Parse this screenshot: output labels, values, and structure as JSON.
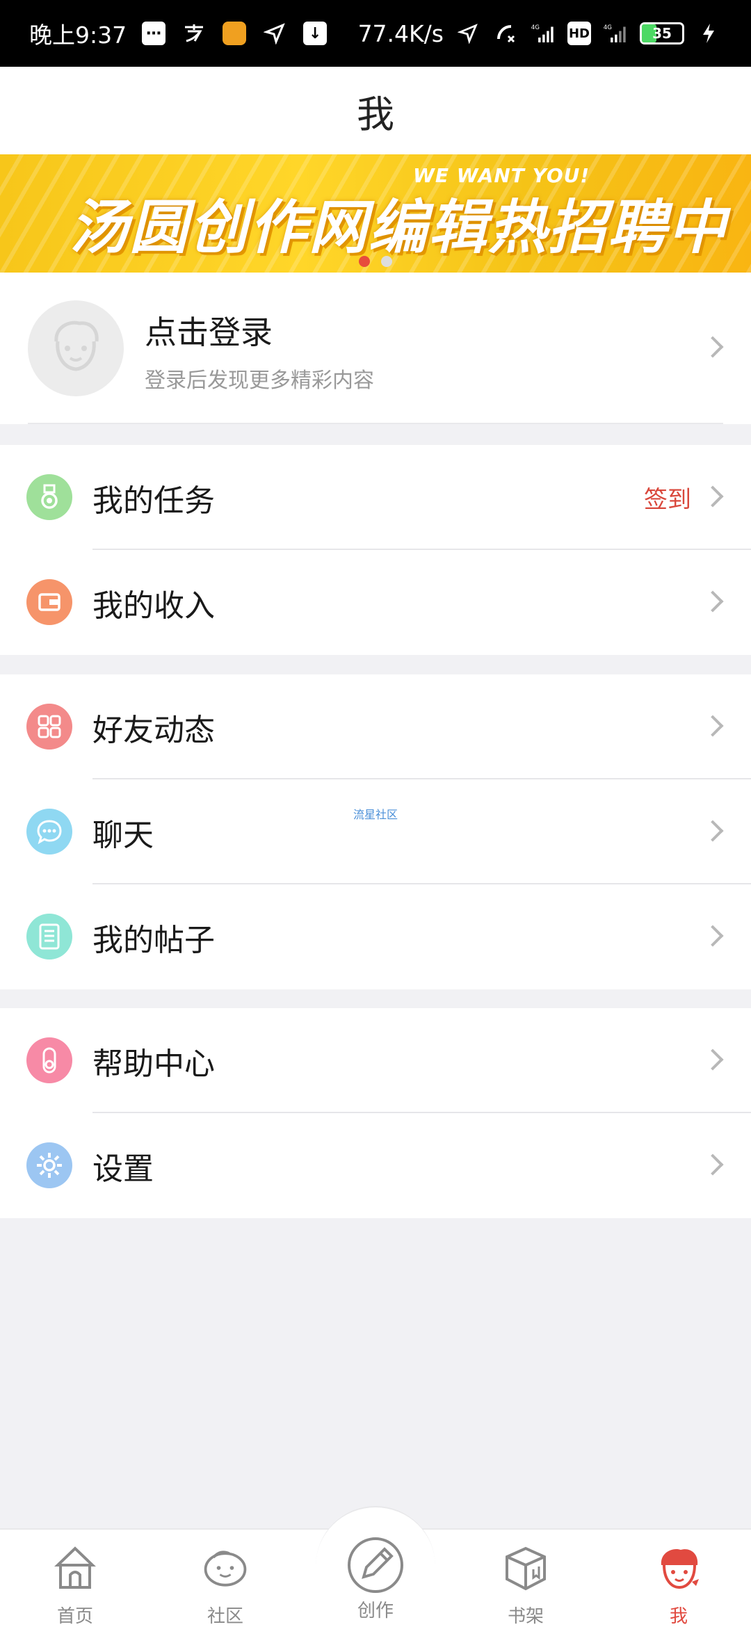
{
  "status_bar": {
    "time": "晚上9:37",
    "network_speed": "77.4K/s",
    "signal_1": "4G",
    "signal_2": "4G",
    "hd_label": "HD",
    "battery_level": "35",
    "icons": [
      "message-icon",
      "alipay-icon",
      "app-icon",
      "location-icon",
      "download-icon",
      "location-arrow-icon",
      "wifi-call-icon",
      "signal-icon",
      "hd-icon",
      "signal-icon",
      "battery-icon",
      "charging-icon"
    ]
  },
  "header": {
    "title": "我"
  },
  "banner": {
    "headline": "汤圆创作网编辑热招聘中",
    "tagline": "WE WANT YOU!",
    "dots": 2,
    "active_dot": 0,
    "colors": {
      "bg": "#ffd629",
      "dot_active": "#e74c3c"
    }
  },
  "profile": {
    "title": "点击登录",
    "subtitle": "登录后发现更多精彩内容"
  },
  "menu_groups": [
    [
      {
        "label": "我的任务",
        "icon": "medal-icon",
        "icon_color": "#9fe09a",
        "badge": "签到"
      },
      {
        "label": "我的收入",
        "icon": "wallet-icon",
        "icon_color": "#f6946a"
      }
    ],
    [
      {
        "label": "好友动态",
        "icon": "grid-icon",
        "icon_color": "#f38a8a"
      },
      {
        "label": "聊天",
        "icon": "chat-bubble-icon",
        "icon_color": "#8fd8f2"
      },
      {
        "label": "我的帖子",
        "icon": "document-icon",
        "icon_color": "#8fe6d6"
      }
    ],
    [
      {
        "label": "帮助中心",
        "icon": "headphones-icon",
        "icon_color": "#f78aa6"
      },
      {
        "label": "设置",
        "icon": "gear-icon",
        "icon_color": "#9cc6f2"
      }
    ]
  ],
  "watermark": "流星社区",
  "bottom_nav": [
    {
      "label": "首页",
      "icon": "home-tent-icon",
      "active": false
    },
    {
      "label": "社区",
      "icon": "community-face-icon",
      "active": false
    },
    {
      "label": "创作",
      "icon": "create-pen-icon",
      "active": false
    },
    {
      "label": "书架",
      "icon": "bookshelf-box-icon",
      "active": false
    },
    {
      "label": "我",
      "icon": "me-face-icon",
      "active": true
    }
  ],
  "colors": {
    "accent": "#e14a40",
    "background": "#f1f1f4"
  }
}
